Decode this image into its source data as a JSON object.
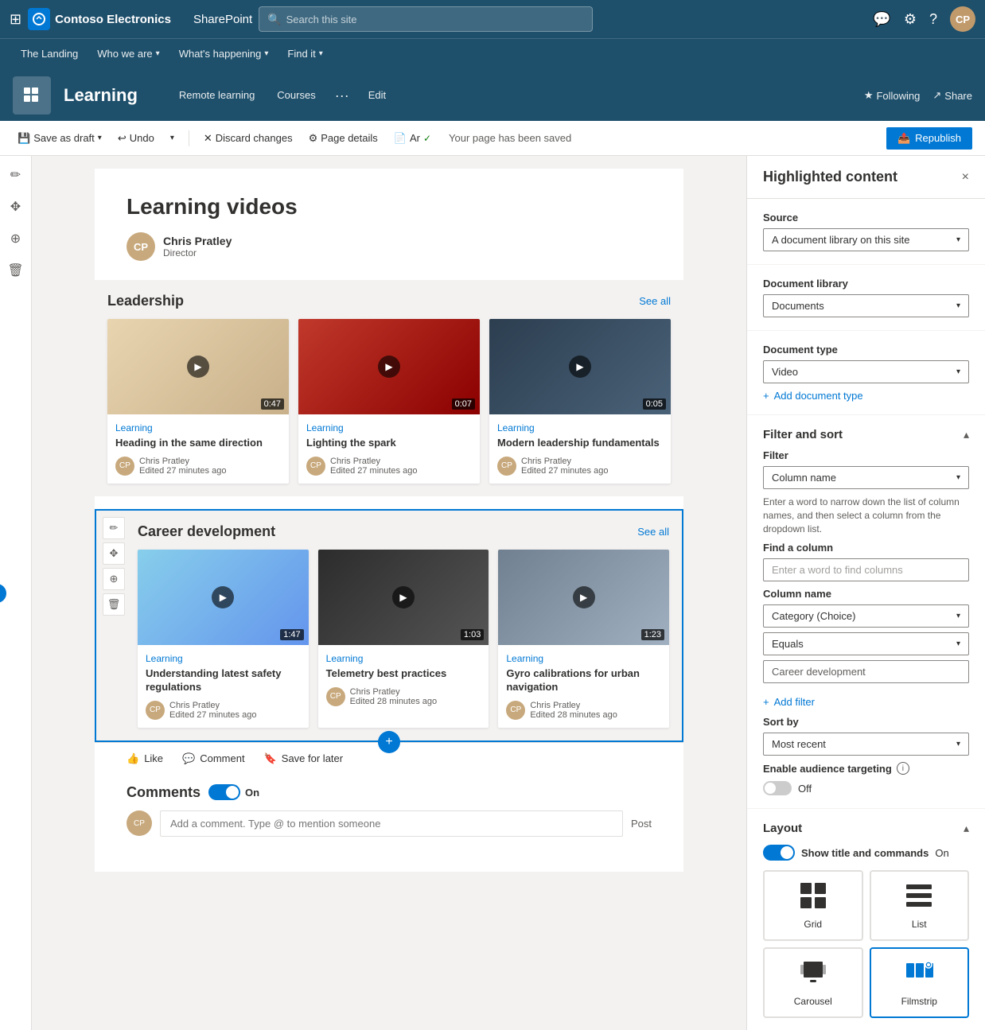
{
  "app": {
    "company": "Contoso Electronics",
    "platform": "SharePoint",
    "search_placeholder": "Search this site"
  },
  "subnav": {
    "items": [
      "The Landing",
      "Who we are",
      "What's happening",
      "Find it"
    ]
  },
  "page_header": {
    "title": "Learning",
    "nav_items": [
      "Remote learning",
      "Courses"
    ],
    "following_label": "Following",
    "share_label": "Share",
    "edit_label": "Edit"
  },
  "toolbar": {
    "save_draft": "Save as draft",
    "undo": "Undo",
    "discard": "Discard changes",
    "page_details": "Page details",
    "ar_label": "Ar",
    "status": "Your page has been saved",
    "republish": "Republish"
  },
  "article": {
    "title": "Learning videos",
    "author_name": "Chris Pratley",
    "author_role": "Director"
  },
  "section1": {
    "title": "Leadership",
    "see_all": "See all",
    "cards": [
      {
        "category": "Learning",
        "title": "Heading in the same direction",
        "author": "Chris Pratley",
        "edited": "Edited 27 minutes ago",
        "duration": "0:47"
      },
      {
        "category": "Learning",
        "title": "Lighting the spark",
        "author": "Chris Pratley",
        "edited": "Edited 27 minutes ago",
        "duration": "0:07"
      },
      {
        "category": "Learning",
        "title": "Modern leadership fundamentals",
        "author": "Chris Pratley",
        "edited": "Edited 27 minutes ago",
        "duration": "0:05"
      }
    ]
  },
  "section2": {
    "title": "Career development",
    "see_all": "See all",
    "cards": [
      {
        "category": "Learning",
        "title": "Understanding latest safety regulations",
        "author": "Chris Pratley",
        "edited": "Edited 27 minutes ago",
        "duration": "1:47"
      },
      {
        "category": "Learning",
        "title": "Telemetry best practices",
        "author": "Chris Pratley",
        "edited": "Edited 28 minutes ago",
        "duration": "1:03"
      },
      {
        "category": "Learning",
        "title": "Gyro calibrations for urban navigation",
        "author": "Chris Pratley",
        "edited": "Edited 28 minutes ago",
        "duration": "1:23"
      }
    ]
  },
  "bottom_bar": {
    "like": "Like",
    "comment": "Comment",
    "save_for_later": "Save for later"
  },
  "comments": {
    "title": "Comments",
    "toggle_on": "On",
    "comment_placeholder": "Add a comment. Type @ to mention someone",
    "post": "Post"
  },
  "right_panel": {
    "title": "Highlighted content",
    "close_icon": "×",
    "source_label": "Source",
    "source_value": "A document library on this site",
    "document_library_label": "Document library",
    "document_library_value": "Documents",
    "document_type_label": "Document type",
    "document_type_value": "Video",
    "add_document_type": "Add document type",
    "filter_sort_title": "Filter and sort",
    "filter_label": "Filter",
    "filter_value": "Column name",
    "filter_note": "Enter a word to narrow down the list of column names, and then select a column from the dropdown list.",
    "find_column_label": "Find a column",
    "find_column_placeholder": "Enter a word to find columns",
    "column_name_label": "Column name",
    "column_name_value": "Category (Choice)",
    "equals_value": "Equals",
    "filter_value_input": "Career development",
    "add_filter": "Add filter",
    "sort_by_label": "Sort by",
    "sort_by_value": "Most recent",
    "audience_targeting_label": "Enable audience targeting",
    "audience_toggle_label": "Off",
    "layout_title": "Layout",
    "show_title_label": "Show title and commands",
    "show_title_toggle": "On",
    "layout_options": [
      {
        "id": "grid",
        "label": "Grid",
        "selected": false
      },
      {
        "id": "list",
        "label": "List",
        "selected": false
      },
      {
        "id": "carousel",
        "label": "Carousel",
        "selected": false
      },
      {
        "id": "filmstrip",
        "label": "Filmstrip",
        "selected": true
      }
    ]
  }
}
